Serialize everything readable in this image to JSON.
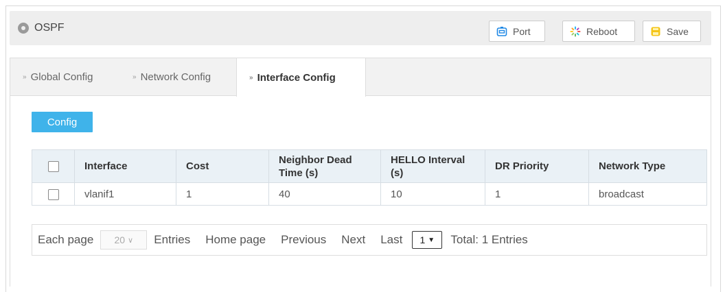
{
  "header": {
    "title": "OSPF",
    "buttons": {
      "port": "Port",
      "reboot": "Reboot",
      "save": "Save"
    }
  },
  "tabs": [
    {
      "label": "Global Config",
      "active": false
    },
    {
      "label": "Network Config",
      "active": false
    },
    {
      "label": "Interface Config",
      "active": true
    }
  ],
  "toolbar": {
    "config_label": "Config"
  },
  "table": {
    "columns": [
      "Interface",
      "Cost",
      "Neighbor Dead Time (s)",
      "HELLO Interval (s)",
      "DR Priority",
      "Network Type"
    ],
    "rows": [
      {
        "interface": "vlanif1",
        "cost": "1",
        "dead_time": "40",
        "hello_interval": "10",
        "dr_priority": "1",
        "network_type": "broadcast"
      }
    ]
  },
  "pager": {
    "each_page": "Each page",
    "page_size": "20",
    "entries": "Entries",
    "home": "Home page",
    "previous": "Previous",
    "next": "Next",
    "last": "Last",
    "current_page": "1",
    "total": "Total: 1 Entries"
  },
  "colors": {
    "accent": "#3fb3ea",
    "header_bg": "#eeeeee",
    "table_head_bg": "#eaf1f6",
    "save_icon": "#f5c518",
    "port_icon": "#1e88e5"
  }
}
